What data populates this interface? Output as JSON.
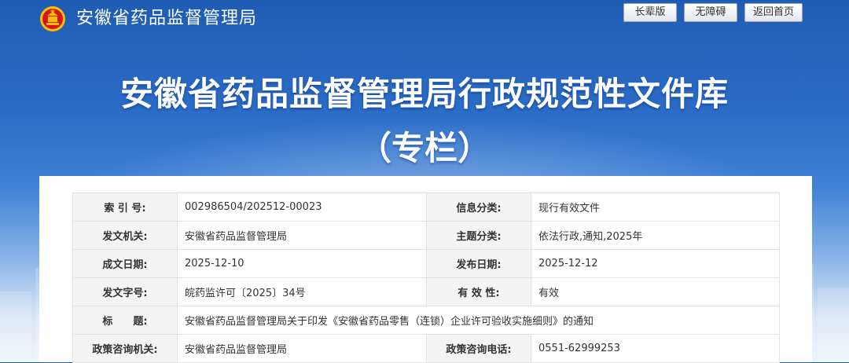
{
  "header": {
    "site_name": "安徽省药品监督管理局",
    "buttons": [
      "长辈版",
      "无障碍",
      "返回首页"
    ],
    "title_main": "安徽省药品监督管理局行政规范性文件库",
    "title_sub": "（专栏）"
  },
  "meta": {
    "rows": [
      [
        {
          "label": "索 引 号:",
          "value": "002986504/202512-00023"
        },
        {
          "label": "信息分类:",
          "value": "现行有效文件"
        }
      ],
      [
        {
          "label": "发文机关:",
          "value": "安徽省药品监督管理局"
        },
        {
          "label": "主题分类:",
          "value": "依法行政,通知,2025年"
        }
      ],
      [
        {
          "label": "成文日期:",
          "value": "2025-12-10"
        },
        {
          "label": "发布日期:",
          "value": "2025-12-12"
        }
      ],
      [
        {
          "label": "发文字号:",
          "value": "皖药监许可〔2025〕34号"
        },
        {
          "label": "有 效 性:",
          "value": "有效"
        }
      ],
      [
        {
          "label": "标　　题:",
          "value": "安徽省药品监督管理局关于印发《安徽省药品零售（连锁）企业许可验收实施细则》的通知",
          "full": true
        }
      ],
      [
        {
          "label": "政策咨询机关:",
          "value": "安徽省药品监督管理局"
        },
        {
          "label": "政策咨询电话:",
          "value": "0551-62999253"
        }
      ]
    ]
  },
  "colors": {
    "header_blue": "#1f5cb4",
    "label_bg": "#f4f4f4",
    "border": "#e2e2e2",
    "emblem_red": "#d8141c",
    "emblem_gold": "#f2c200"
  },
  "icons": [
    "national-emblem-icon"
  ]
}
